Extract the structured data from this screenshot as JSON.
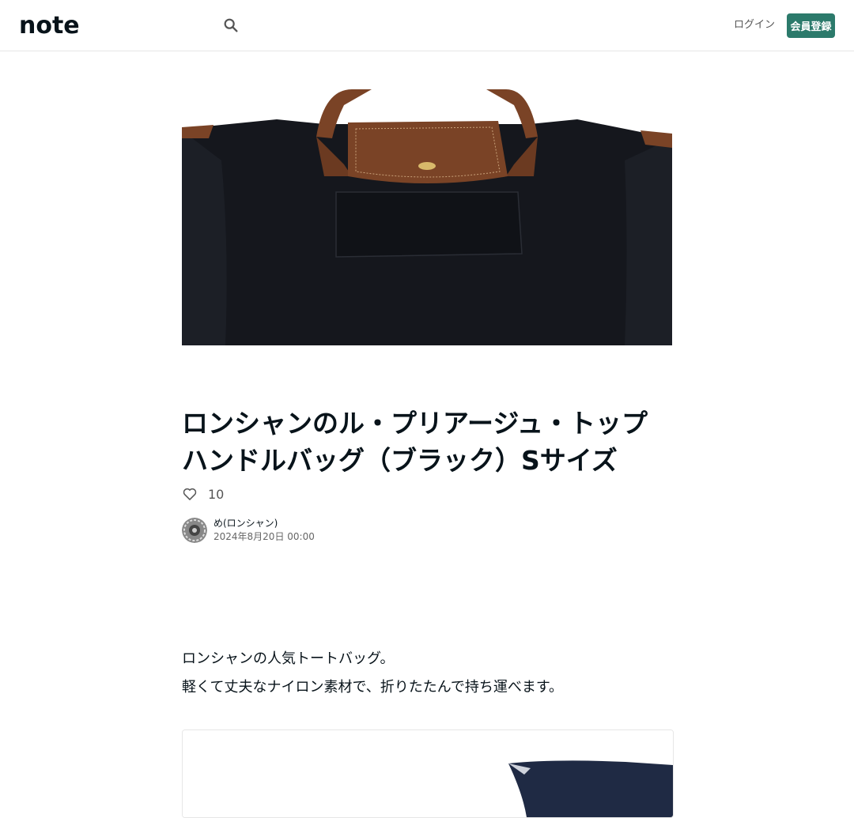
{
  "header": {
    "logo_text": "note",
    "login_label": "ログイン",
    "signup_label": "会員登録"
  },
  "article": {
    "title": "ロンシャンのル・プリアージュ・トップハンドルバッグ（ブラック）Sサイズ",
    "like_count": "10",
    "author_name": "め(ロンシャン)",
    "published_at": "2024年8月20日 00:00",
    "body_lines": [
      "ロンシャンの人気トートバッグ。",
      "軽くて丈夫なナイロン素材で、折りたたんで持ち運べます。"
    ]
  },
  "colors": {
    "accent": "#2c7a6b",
    "bag_body": "#17191f",
    "bag_leather": "#7a4326"
  }
}
